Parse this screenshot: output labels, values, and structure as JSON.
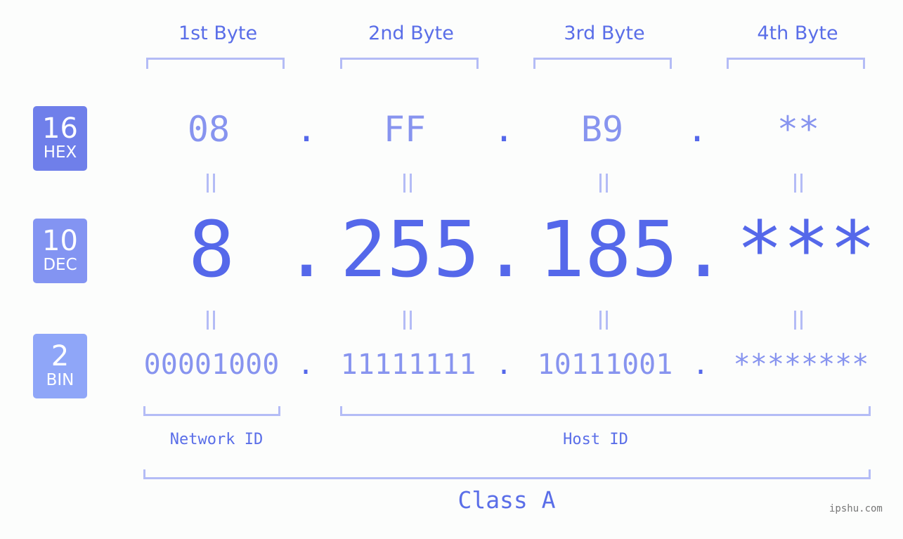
{
  "byte_headers": [
    "1st Byte",
    "2nd Byte",
    "3rd Byte",
    "4th Byte"
  ],
  "rows": {
    "hex": {
      "base": "16",
      "label": "HEX",
      "color": "#6f7fea",
      "values": [
        "08",
        "FF",
        "B9",
        "**"
      ]
    },
    "dec": {
      "base": "10",
      "label": "DEC",
      "color": "#8394f2",
      "values": [
        "8",
        "255",
        "185",
        "***"
      ]
    },
    "bin": {
      "base": "2",
      "label": "BIN",
      "color": "#8fa6f8",
      "values": [
        "00001000",
        "11111111",
        "10111001",
        "********"
      ]
    }
  },
  "separator": ".",
  "network_label": "Network ID",
  "host_label": "Host ID",
  "class_label": "Class A",
  "watermark": "ipshu.com",
  "colors": {
    "accent": "#5568ea",
    "light": "#8794ef",
    "bracket": "#b4bcf6"
  }
}
